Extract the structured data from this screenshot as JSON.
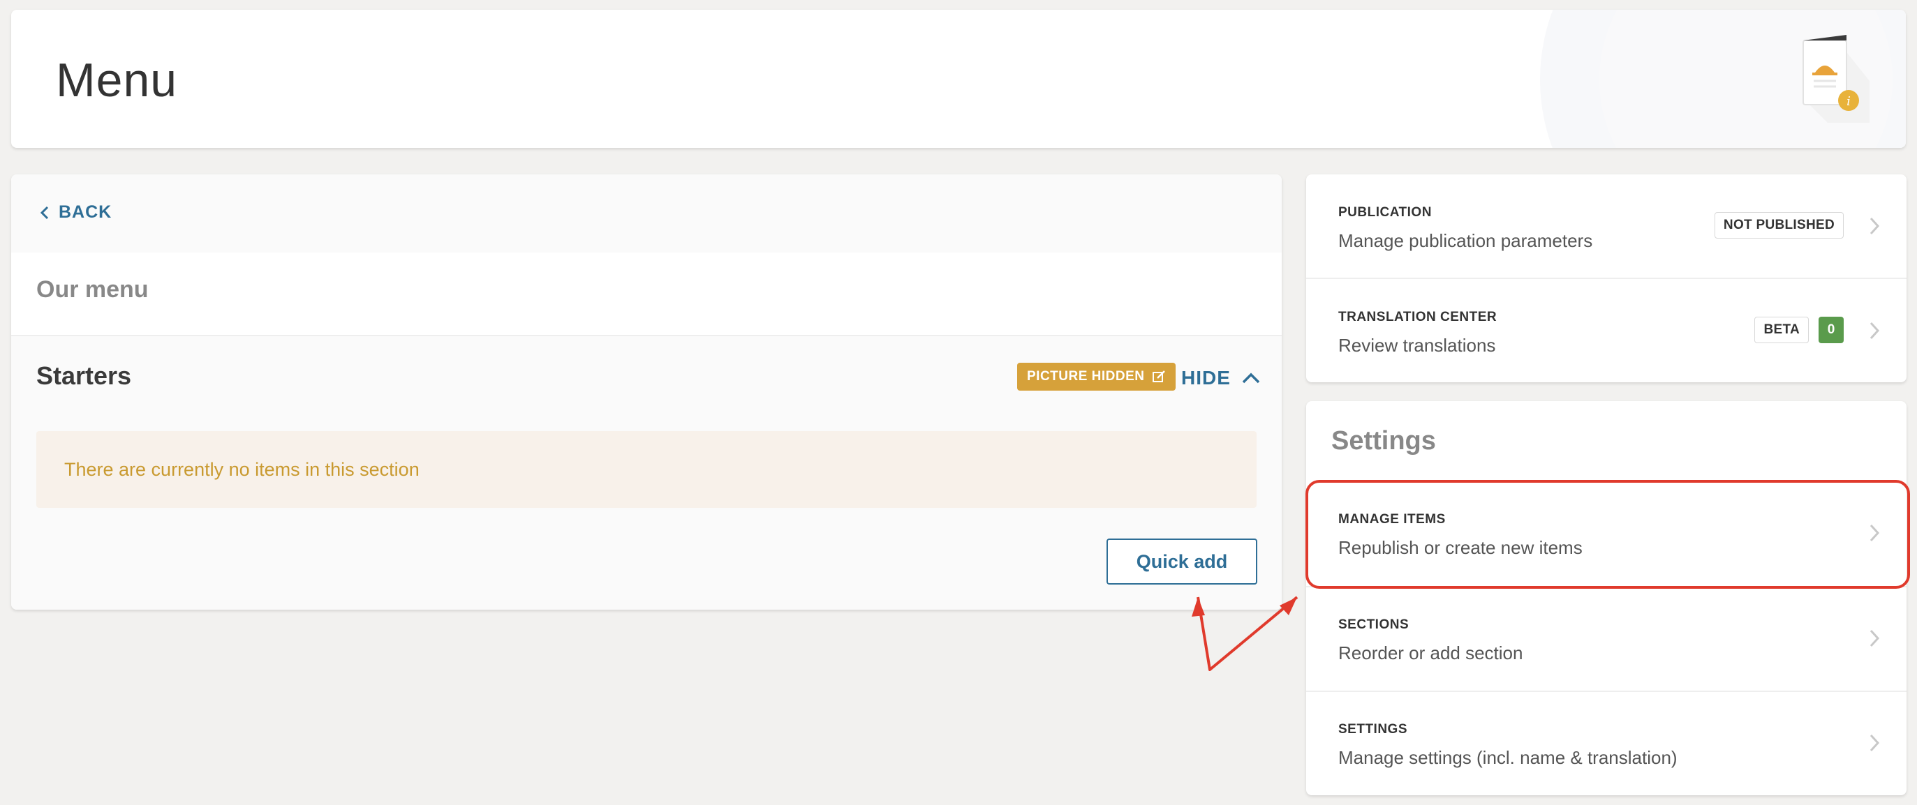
{
  "header": {
    "title": "Menu"
  },
  "left_panel": {
    "back_label": "BACK",
    "menu_name": "Our menu",
    "section": {
      "title": "Starters",
      "picture_badge": "PICTURE HIDDEN",
      "hide_label": "HIDE",
      "empty_message": "There are currently no items in this section",
      "quick_add_label": "Quick add"
    }
  },
  "right_top": {
    "publication": {
      "label": "PUBLICATION",
      "description": "Manage publication parameters",
      "status_badge": "NOT PUBLISHED"
    },
    "translation": {
      "label": "TRANSLATION CENTER",
      "description": "Review translations",
      "beta_badge": "BETA",
      "count": "0"
    }
  },
  "settings_panel": {
    "heading": "Settings",
    "rows": [
      {
        "label": "MANAGE ITEMS",
        "description": "Republish or create new items"
      },
      {
        "label": "SECTIONS",
        "description": "Reorder or add section"
      },
      {
        "label": "SETTINGS",
        "description": "Manage settings (incl. name & translation)"
      }
    ]
  },
  "colors": {
    "accent_blue": "#2e6e96",
    "badge_gold": "#d6a13a",
    "empty_text": "#c99a30",
    "count_green": "#5a9b4c",
    "annotation_red": "#e03a2c"
  },
  "icons": [
    "chevron-left-icon",
    "edit-icon",
    "chevron-up-icon",
    "chevron-right-icon",
    "menu-illustration-icon",
    "info-icon"
  ]
}
